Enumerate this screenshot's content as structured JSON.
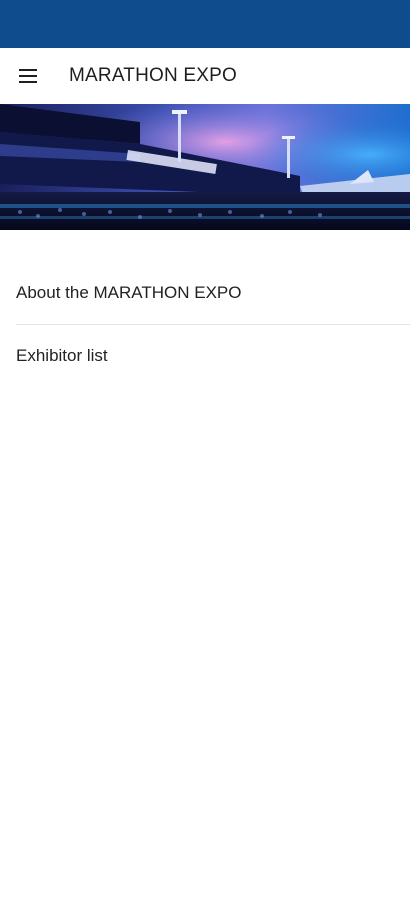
{
  "app_bar": {
    "title": "MARATHON EXPO",
    "menu_icon": "hamburger-menu-icon"
  },
  "colors": {
    "status_bar": "#0f4c8e",
    "background": "#ffffff",
    "text": "#222222",
    "divider": "#e3e3e3"
  },
  "hero_image": {
    "description_icon": "expo-hall-banner-image"
  },
  "menu": {
    "items": [
      {
        "label": "About the MARATHON EXPO"
      },
      {
        "label": "Exhibitor list"
      }
    ]
  }
}
